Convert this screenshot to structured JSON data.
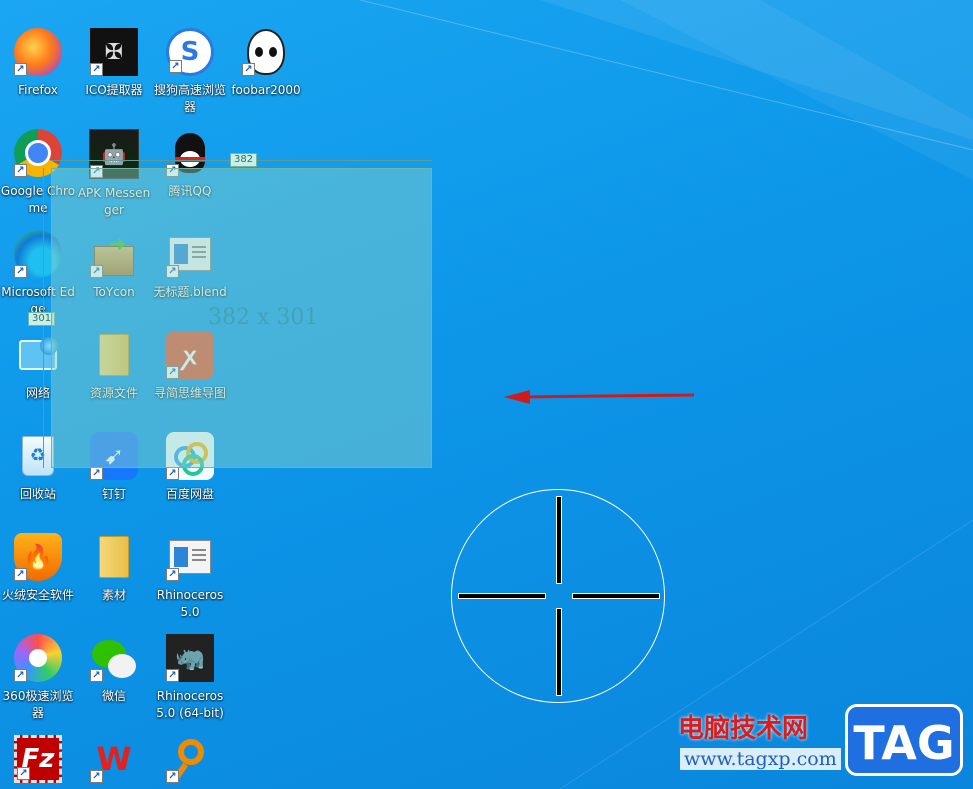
{
  "desktop": {
    "icons": [
      {
        "label": "Firefox",
        "icon": "firefox-icon"
      },
      {
        "label": "ICO提取器",
        "icon": "ico-extractor-icon"
      },
      {
        "label": "搜狗高速浏览器",
        "icon": "sogou-browser-icon"
      },
      {
        "label": "foobar2000",
        "icon": "foobar2000-icon"
      },
      {
        "label": "Google Chrome",
        "icon": "chrome-icon"
      },
      {
        "label": "APK Messenger",
        "icon": "apk-messenger-icon"
      },
      {
        "label": "腾讯QQ",
        "icon": "qq-icon"
      },
      {
        "label": "Microsoft Edge",
        "icon": "edge-icon"
      },
      {
        "label": "ToYcon",
        "icon": "toycon-icon"
      },
      {
        "label": "无标题.blend",
        "icon": "blend-file-icon"
      },
      {
        "label": "网络",
        "icon": "network-icon"
      },
      {
        "label": "资源文件",
        "icon": "folder-icon"
      },
      {
        "label": "寻简思维导图",
        "icon": "xunjian-mindmap-icon"
      },
      {
        "label": "回收站",
        "icon": "recycle-bin-icon"
      },
      {
        "label": "钉钉",
        "icon": "dingtalk-icon"
      },
      {
        "label": "百度网盘",
        "icon": "baidu-netdisk-icon"
      },
      {
        "label": "火绒安全软件",
        "icon": "huorong-icon"
      },
      {
        "label": "素材",
        "icon": "folder-icon"
      },
      {
        "label": "Rhinoceros 5.0",
        "icon": "rhinoceros-icon"
      },
      {
        "label": "360极速浏览器",
        "icon": "360-browser-icon"
      },
      {
        "label": "微信",
        "icon": "wechat-icon"
      },
      {
        "label": "Rhinoceros 5.0 (64-bit)",
        "icon": "rhinoceros64-icon"
      },
      {
        "label": "",
        "icon": "filezilla-icon"
      },
      {
        "label": "",
        "icon": "wps-icon"
      },
      {
        "label": "",
        "icon": "magnifier-tool-icon"
      }
    ]
  },
  "selection": {
    "width_label": "382",
    "height_label": "301",
    "size_text": "382 x 301"
  },
  "watermark": {
    "title": "电脑技术网",
    "url": "www.tagxp.com",
    "badge": "TAG"
  },
  "colors": {
    "desktop_bg": "#0d96e8",
    "selection_fill": "#8cd2c8",
    "arrow": "#d01b1b",
    "watermark_red": "#d31f1f",
    "watermark_blue": "#1f6fe0"
  }
}
